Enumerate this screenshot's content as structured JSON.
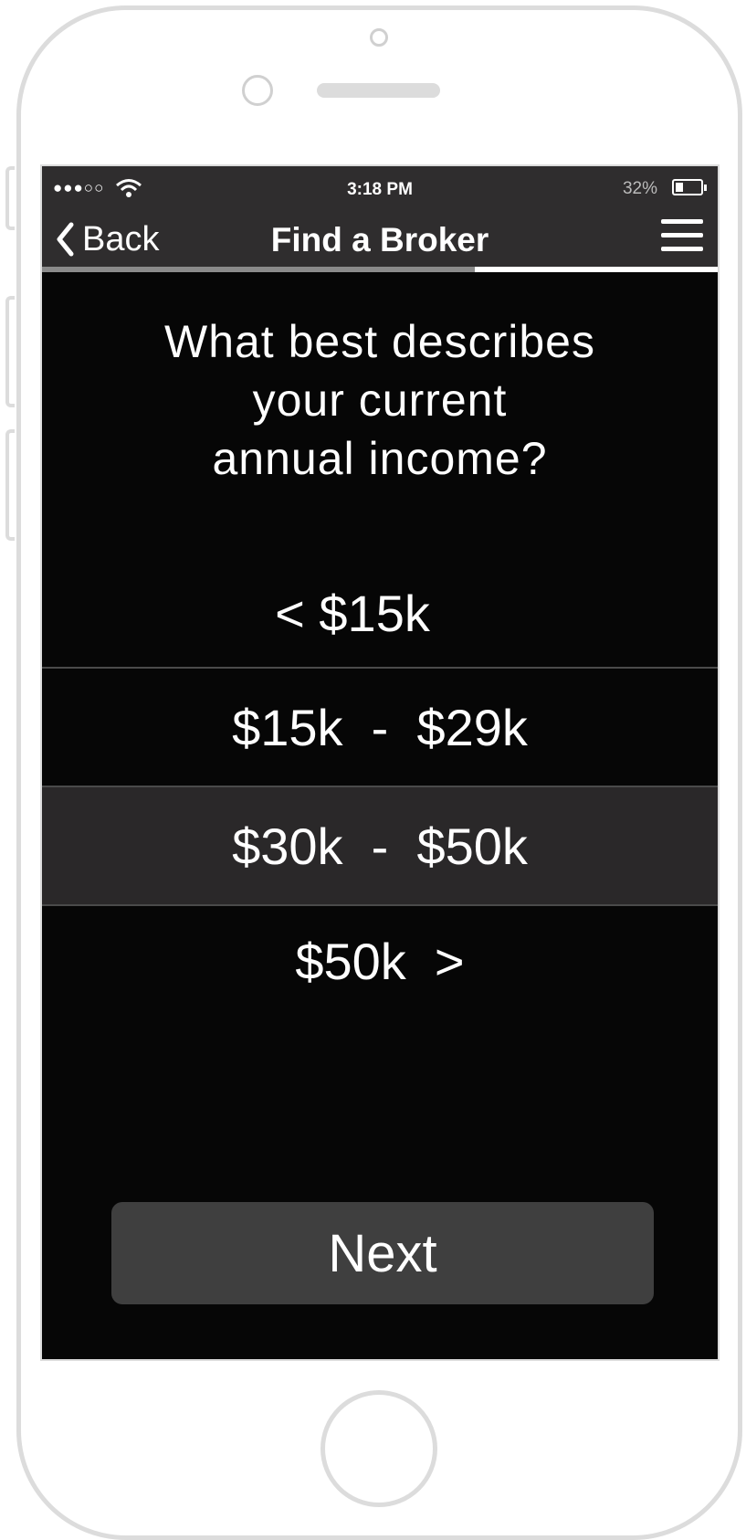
{
  "status_bar": {
    "signal": "●●●○○",
    "time": "3:18 PM",
    "battery_percent": "32%",
    "battery_level": 0.32
  },
  "nav": {
    "back_label": "Back",
    "title": "Find a Broker"
  },
  "progress": 0.36,
  "question": {
    "line1": "What best describes",
    "line2": "your current",
    "line3": "annual income?"
  },
  "options": [
    {
      "label": "< $15k"
    },
    {
      "label": "$15k  -  $29k"
    },
    {
      "label": "$30k  -  $50k",
      "selected": true
    },
    {
      "label": "$50k  >"
    }
  ],
  "next_label": "Next",
  "colors": {
    "bar_bg": "#2f2d2e",
    "screen_bg": "#060606",
    "selected_bg": "#2a2829",
    "button_bg": "#3f3f3f"
  }
}
